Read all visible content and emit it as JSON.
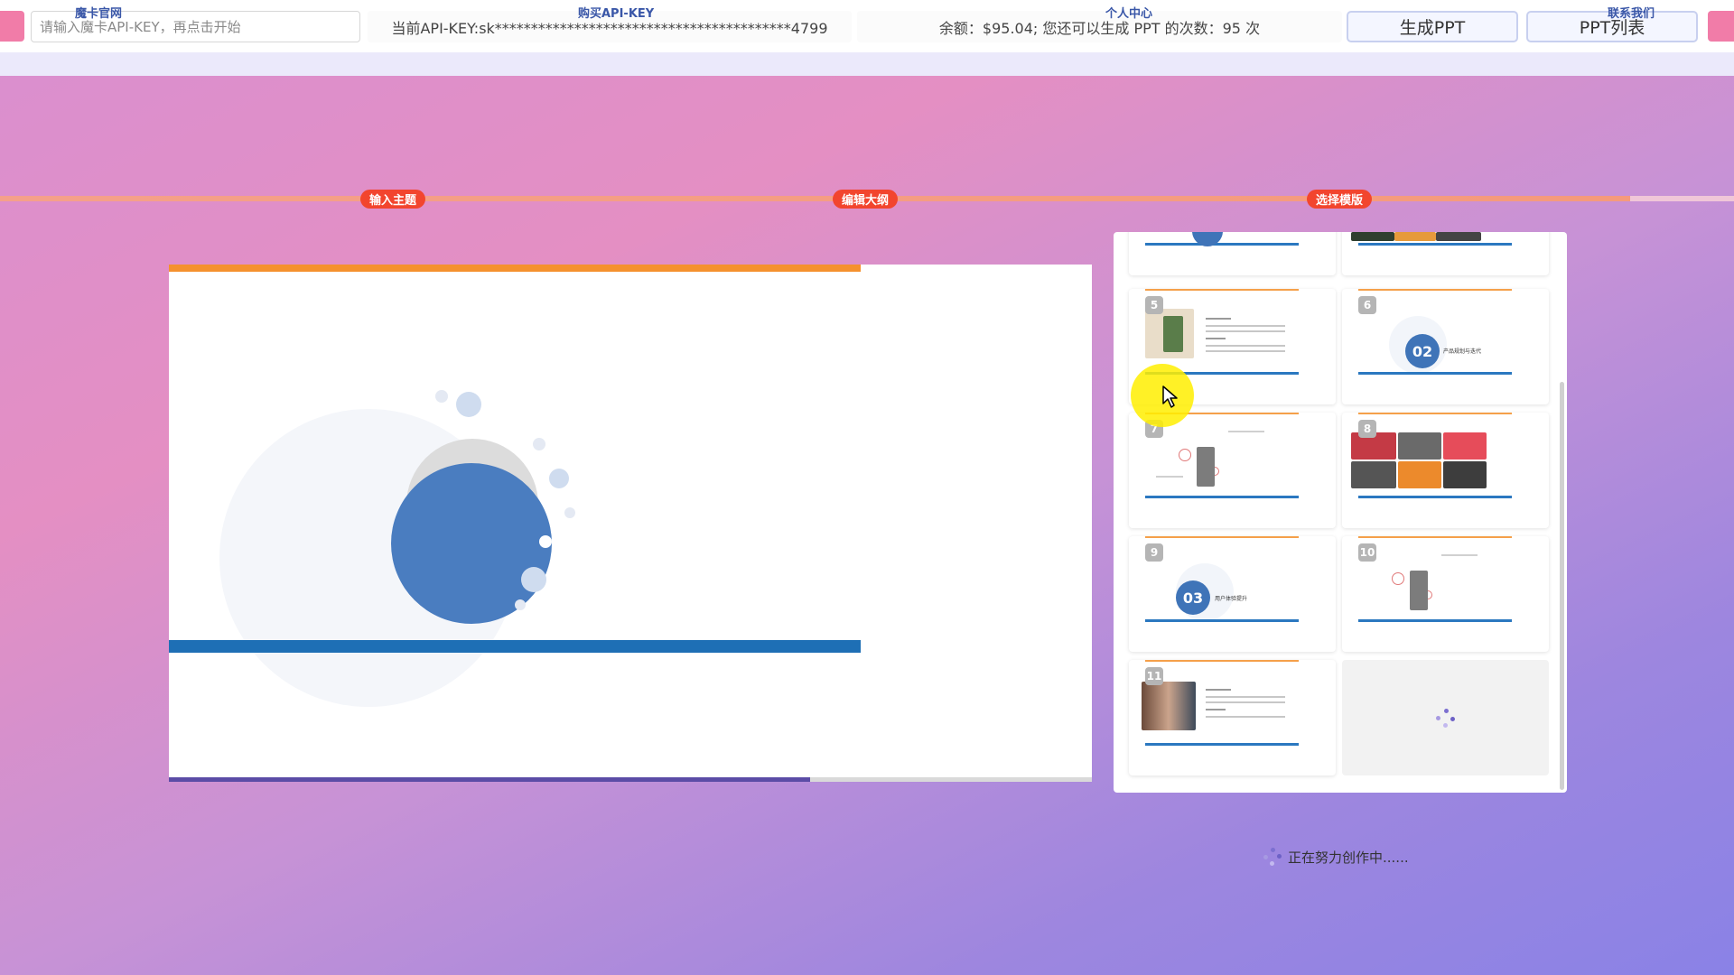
{
  "toolbar": {
    "apikey_placeholder": "请输入魔卡API-KEY，再点击开始",
    "current_key_text": "当前API-KEY:sk*****************************************4799",
    "balance_text": "余额：$95.04; 您还可以生成 PPT 的次数：95 次",
    "generate_label": "生成PPT",
    "list_label": "PPT列表"
  },
  "nav": {
    "items": [
      "魔卡官网",
      "购买API-KEY",
      "个人中心",
      "联系我们"
    ]
  },
  "steps": {
    "items": [
      "输入主题",
      "编辑大纲",
      "选择模版"
    ],
    "progress": 0.94
  },
  "preview": {
    "load_progress": 0.695
  },
  "thumbnails": {
    "numbers": [
      "5",
      "6",
      "7",
      "8",
      "9",
      "10",
      "11"
    ],
    "badge_6": "02",
    "badge_9": "03",
    "caption_6": "产品规划与迭代",
    "caption_9": "用户体验提升"
  },
  "status": {
    "text": "正在努力创作中......"
  },
  "colors": {
    "accent_pink": "#f17ca8",
    "step_badge": "#f2452e",
    "slide_orange": "#f5912e",
    "slide_blue": "#1e6fb5",
    "circle_blue": "#4a7dc0"
  }
}
